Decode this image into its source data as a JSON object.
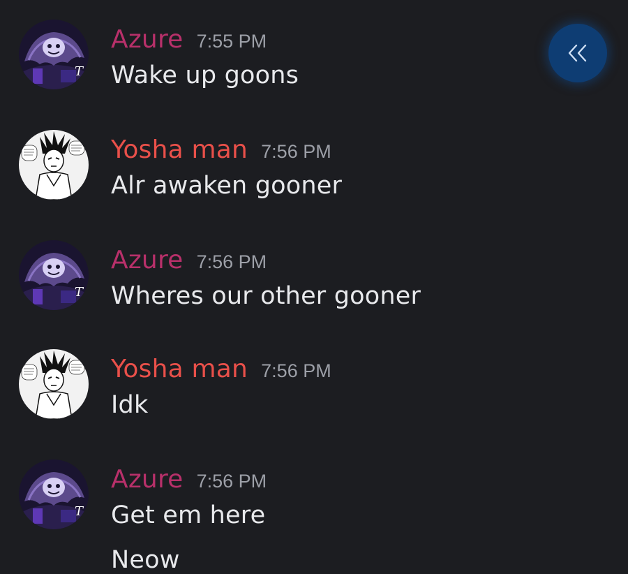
{
  "colors": {
    "background": "#1c1d21",
    "azure_name": "#b8306a",
    "yosha_name": "#e9504a",
    "timestamp": "#9da0a8",
    "message_text": "#e8e9ec",
    "collapse_button": "#0e3d73"
  },
  "collapse_button": {
    "icon": "double-chevron-left-icon"
  },
  "messages": [
    {
      "author": "Azure",
      "time": "7:55 PM",
      "avatar": "purple-ghost-avatar",
      "lines": [
        "Wake up goons"
      ]
    },
    {
      "author": "Yosha man",
      "time": "7:56 PM",
      "avatar": "manga-character-avatar",
      "lines": [
        "Alr awaken gooner"
      ]
    },
    {
      "author": "Azure",
      "time": "7:56 PM",
      "avatar": "purple-ghost-avatar",
      "lines": [
        "Wheres our other gooner"
      ]
    },
    {
      "author": "Yosha man",
      "time": "7:56 PM",
      "avatar": "manga-character-avatar",
      "lines": [
        "Idk"
      ]
    },
    {
      "author": "Azure",
      "time": "7:56 PM",
      "avatar": "purple-ghost-avatar",
      "lines": [
        "Get em here",
        "Neow"
      ]
    }
  ]
}
